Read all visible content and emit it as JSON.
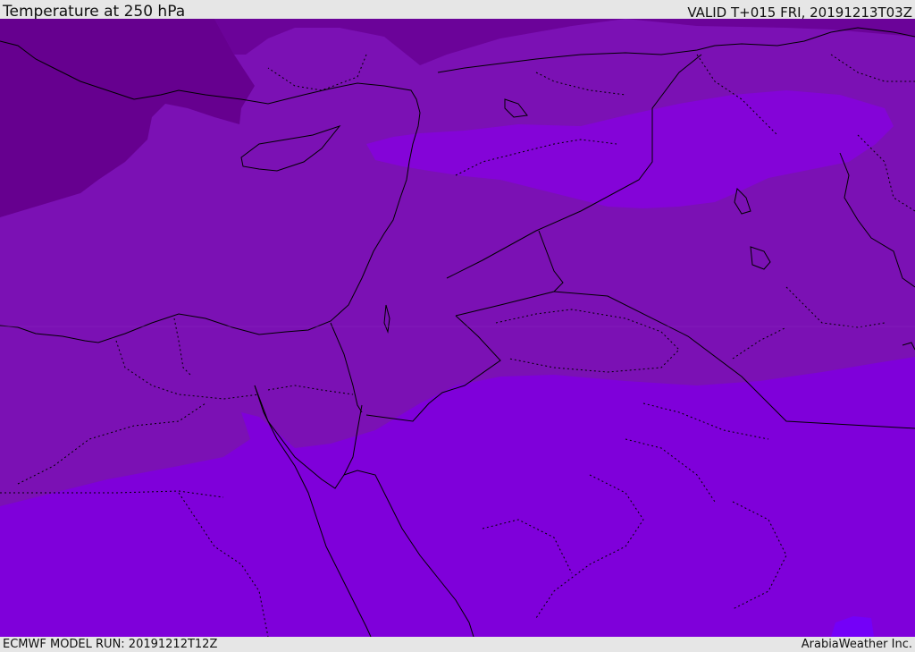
{
  "header": {
    "title": "Temperature at 250 hPa",
    "valid_time": "VALID T+015 FRI, 20191213T03Z"
  },
  "footer": {
    "model_run": "ECMWF MODEL RUN: 20191212T12Z",
    "credit": "ArabiaWeather Inc."
  },
  "map": {
    "variable": "temperature",
    "level": "250 hPa",
    "fill_colors": {
      "coldest_northwest": "#66008f",
      "mid_band": "#7b11b4",
      "warm_band_north": "#8404d8",
      "warmest_south": "#7f00da",
      "hotspot_bottom_right": "#7400f8"
    },
    "coastline_color": "#000000",
    "border_color": "#000000"
  }
}
